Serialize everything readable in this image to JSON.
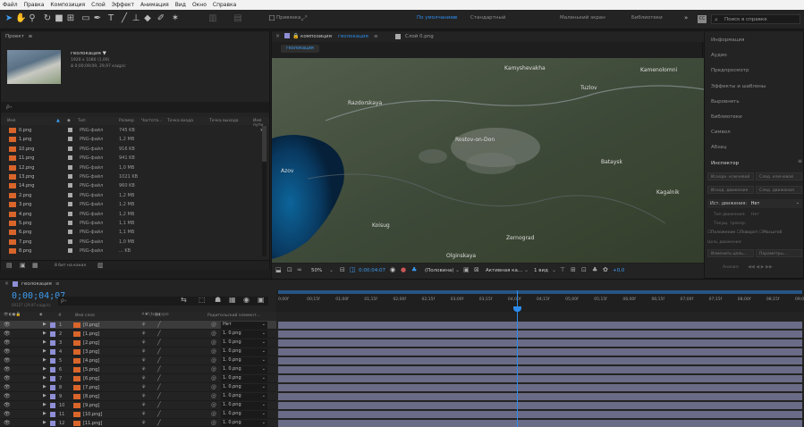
{
  "menu": [
    "Файл",
    "Правка",
    "Композиция",
    "Слой",
    "Эффект",
    "Анимация",
    "Вид",
    "Окно",
    "Справка"
  ],
  "toolbar": {
    "workspace": "По умолчанию",
    "ws_menu": "≡",
    "standard": "Стандартный",
    "small_screen": "Маленький экран",
    "libraries": "Библиотеки",
    "more": "»",
    "search_placeholder": "Поиск в справке",
    "hint_text": "Привязка"
  },
  "project": {
    "title": "Проект",
    "title_menu": "≡",
    "comp_name": "геолокация ▼",
    "comp_size": "1920 x 1080 (1,00)",
    "comp_duration": "Δ 0;00;09;09, 29,97 кадр/с",
    "search_glyph": "ρ₊",
    "columns": [
      "Имя",
      "Тип",
      "Размер",
      "Частота...",
      "Точка входа",
      "Точка выхода",
      "Имя пути"
    ],
    "files": [
      {
        "name": "0.png",
        "type": "PNG-файл",
        "size": "745 KB"
      },
      {
        "name": "1.png",
        "type": "PNG-файл",
        "size": "1,2 MB"
      },
      {
        "name": "10.png",
        "type": "PNG-файл",
        "size": "916 KB"
      },
      {
        "name": "11.png",
        "type": "PNG-файл",
        "size": "941 KB"
      },
      {
        "name": "12.png",
        "type": "PNG-файл",
        "size": "1,0 MB"
      },
      {
        "name": "13.png",
        "type": "PNG-файл",
        "size": "1021 KB"
      },
      {
        "name": "14.png",
        "type": "PNG-файл",
        "size": "960 KB"
      },
      {
        "name": "2.png",
        "type": "PNG-файл",
        "size": "1,2 MB"
      },
      {
        "name": "3.png",
        "type": "PNG-файл",
        "size": "1,2 MB"
      },
      {
        "name": "4.png",
        "type": "PNG-файл",
        "size": "1,2 MB"
      },
      {
        "name": "5.png",
        "type": "PNG-файл",
        "size": "1,1 MB"
      },
      {
        "name": "6.png",
        "type": "PNG-файл",
        "size": "1,1 MB"
      },
      {
        "name": "7.png",
        "type": "PNG-файл",
        "size": "1,0 MB"
      },
      {
        "name": "8.png",
        "type": "PNG-файл",
        "size": "... KB"
      }
    ],
    "bpc": "8 бит на канал"
  },
  "viewer": {
    "snap_label": "Привязка",
    "comp_tab": "композиция",
    "comp_tab_name": "геолокация",
    "comp_tab_menu": "≡",
    "layer_tab": "Слой 0.png",
    "crumb": "геолокация",
    "zoom": "50%",
    "timecode": "0;00;04;07",
    "resolution": "(Половина)",
    "camera": "Активная ка...",
    "views": "1 вид",
    "exposure": "+0,0",
    "map_labels": [
      "Kamyshevakha",
      "Kamenolomni",
      "Tuzlov",
      "Razdorskaya",
      "Rostov-on-Don",
      "Bataysk",
      "Azov",
      "Kagalnik",
      "Koisug",
      "Zernograd",
      "Olginskaya"
    ]
  },
  "right_panel": {
    "items": [
      "Информация",
      "Аудио",
      "Предпросмотр",
      "Эффекты и шаблоны",
      "Выровнять",
      "Библиотеки",
      "Символ",
      "Абзац",
      "Инспектор"
    ],
    "inspector_menu": "≡",
    "inspector_fields": [
      "Исходн. ключевой",
      "След. ключевой",
      "Исход. движения",
      "След. движения"
    ],
    "motion_source_label": "Ист. движения:",
    "motion_source_value": "Нет",
    "track_type": "Тип движения:",
    "track_type_value": "Нет",
    "current_track": "Текущ. трекер:",
    "track_options": [
      "Положение",
      "Поворот",
      "Масштаб"
    ],
    "motion_target": "Цель движения:",
    "edit_target": "Изменить цель...",
    "options": "Параметры...",
    "analyze": "Анализ:"
  },
  "timeline": {
    "comp_name": "геолокация",
    "menu": "≡",
    "timecode": "0;00;04;07",
    "timecode_sub": "00127 (29,97 кадр/с)",
    "search_glyph": "ρ₊",
    "col_name": "Имя слоя",
    "col_num": "#",
    "col_parent": "Родительский элемент...",
    "ruler": [
      "0;00f",
      "00;15f",
      "01;00f",
      "01;15f",
      "02;00f",
      "02;15f",
      "03;00f",
      "03;15f",
      "04;00f",
      "04;15f",
      "05;00f",
      "05;15f",
      "06;00f",
      "06;15f",
      "07;00f",
      "07;15f",
      "08;00f",
      "08;15f",
      "09;00f"
    ],
    "layers": [
      {
        "num": "1",
        "name": "[0.png]",
        "parent": "Нет"
      },
      {
        "num": "2",
        "name": "[1.png]",
        "parent": "1. 0.png"
      },
      {
        "num": "3",
        "name": "[2.png]",
        "parent": "1. 0.png"
      },
      {
        "num": "4",
        "name": "[3.png]",
        "parent": "1. 0.png"
      },
      {
        "num": "5",
        "name": "[4.png]",
        "parent": "1. 0.png"
      },
      {
        "num": "6",
        "name": "[5.png]",
        "parent": "1. 0.png"
      },
      {
        "num": "7",
        "name": "[6.png]",
        "parent": "1. 0.png"
      },
      {
        "num": "8",
        "name": "[7.png]",
        "parent": "1. 0.png"
      },
      {
        "num": "9",
        "name": "[8.png]",
        "parent": "1. 0.png"
      },
      {
        "num": "10",
        "name": "[9.png]",
        "parent": "1. 0.png"
      },
      {
        "num": "11",
        "name": "[10.png]",
        "parent": "1. 0.png"
      },
      {
        "num": "12",
        "name": "[11.png]",
        "parent": "1. 0.png"
      }
    ],
    "playhead_fraction": 0.455
  },
  "colors": {
    "accent": "#2d8ceb",
    "label_violet": "#8f8fd6",
    "png_orange": "#d9652b",
    "track_bar": "#6a6b86"
  }
}
